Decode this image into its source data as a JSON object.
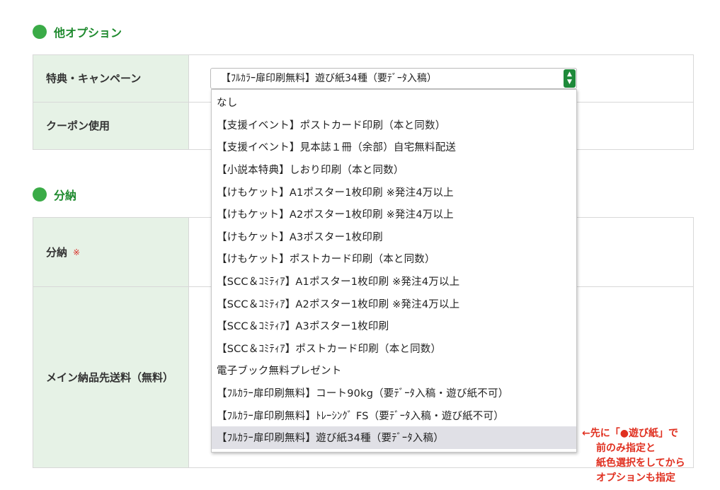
{
  "sections": {
    "other_options": {
      "title": "他オプション"
    },
    "installment": {
      "title": "分納"
    }
  },
  "form": {
    "campaign_label": "特典・キャンペーン",
    "coupon_label": "クーポン使用",
    "installment_label": "分納",
    "required_mark": "※",
    "main_shipping_label": "メイン納品先送料（無料）"
  },
  "campaign_select": {
    "selected_value": "【ﾌﾙｶﾗｰ扉印刷無料】遊び紙34種（要ﾃﾞｰﾀ入稿）",
    "options": [
      "なし",
      "【支援イベント】ポストカード印刷（本と同数）",
      "【支援イベント】見本誌１冊（余部）自宅無料配送",
      "【小説本特典】しおり印刷（本と同数）",
      "【けもケット】A1ポスター1枚印刷 ※発注4万以上",
      "【けもケット】A2ポスター1枚印刷 ※発注4万以上",
      "【けもケット】A3ポスター1枚印刷",
      "【けもケット】ポストカード印刷（本と同数）",
      "【SCC＆ｺﾐﾃｨｱ】A1ポスター1枚印刷 ※発注4万以上",
      "【SCC＆ｺﾐﾃｨｱ】A2ポスター1枚印刷 ※発注4万以上",
      "【SCC＆ｺﾐﾃｨｱ】A3ポスター1枚印刷",
      "【SCC＆ｺﾐﾃｨｱ】ポストカード印刷（本と同数）",
      "電子ブック無料プレゼント",
      "【ﾌﾙｶﾗｰ扉印刷無料】コート90kg（要ﾃﾞｰﾀ入稿・遊び紙不可）",
      "【ﾌﾙｶﾗｰ扉印刷無料】ﾄﾚｰｼﾝｸﾞ FS（要ﾃﾞｰﾀ入稿・遊び紙不可）",
      "【ﾌﾙｶﾗｰ扉印刷無料】遊び紙34種（要ﾃﾞｰﾀ入稿）"
    ],
    "selected_index": 15
  },
  "annotation": {
    "line1": "←先に「●遊び紙」で",
    "line2": "前のみ指定と",
    "line3": "紙色選択をしてから",
    "line4": "オプションも指定"
  },
  "colors": {
    "heading_green": "#1e8a2e",
    "label_bg": "#e6f2e6",
    "select_arrow": "#1e8a3a",
    "required_red": "#d9322b",
    "annotation_red": "#e03020"
  },
  "icons": {
    "heading_bullet": "green-circle",
    "select_arrow": "up-down-chevron"
  }
}
